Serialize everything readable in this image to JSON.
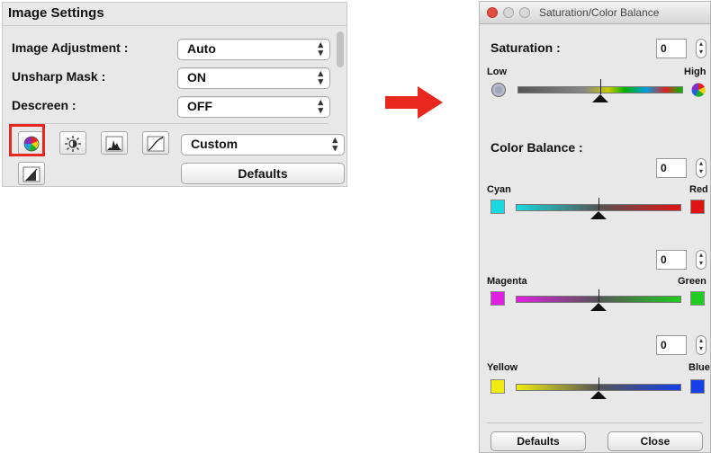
{
  "image_settings": {
    "title": "Image Settings",
    "rows": [
      {
        "label": "Image Adjustment :",
        "value": "Auto"
      },
      {
        "label": "Unsharp Mask :",
        "value": "ON"
      },
      {
        "label": "Descreen :",
        "value": "OFF"
      }
    ],
    "tone_select": "Custom",
    "defaults_label": "Defaults",
    "tools": [
      "saturation-color-balance-icon",
      "brightness-contrast-icon",
      "histogram-icon",
      "tone-curve-icon",
      "threshold-icon"
    ]
  },
  "window": {
    "title": "Saturation/Color Balance",
    "saturation": {
      "label": "Saturation :",
      "value": "0",
      "low": "Low",
      "high": "High",
      "level": 0.5
    },
    "color_balance": {
      "label": "Color Balance :",
      "cyan_red": {
        "value": "0",
        "left": "Cyan",
        "right": "Red",
        "left_color": "#19d8e0",
        "right_color": "#e01313",
        "level": 0.5
      },
      "magenta_green": {
        "value": "0",
        "left": "Magenta",
        "right": "Green",
        "left_color": "#e020e0",
        "right_color": "#20cc20",
        "level": 0.5
      },
      "yellow_blue": {
        "value": "0",
        "left": "Yellow",
        "right": "Blue",
        "left_color": "#f0ec10",
        "right_color": "#1540e8",
        "level": 0.5
      }
    },
    "defaults_label": "Defaults",
    "close_label": "Close"
  },
  "colors": {
    "highlight": "#e8271f",
    "arrow": "#e8271f"
  }
}
